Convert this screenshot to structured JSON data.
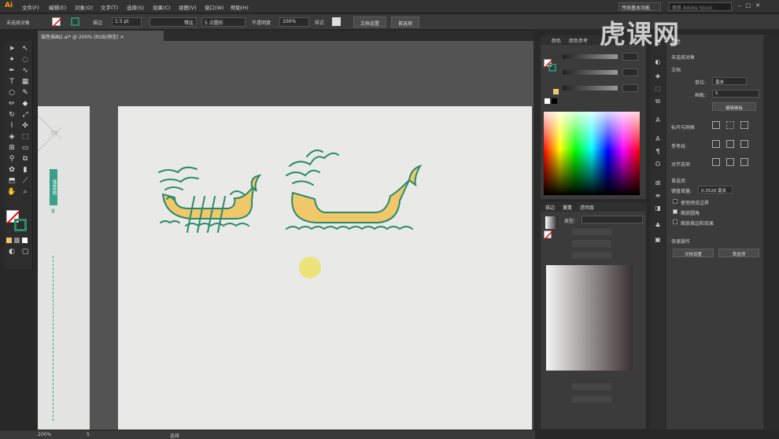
{
  "app": {
    "logo": "Ai",
    "menu": [
      "文件(F)",
      "编辑(E)",
      "对象(O)",
      "文字(T)",
      "选择(S)",
      "效果(C)",
      "视图(V)",
      "窗口(W)",
      "帮助(H)"
    ],
    "workspace": "传统基本功能",
    "search_placeholder": "搜索 Adobe Stock"
  },
  "control": {
    "selection": "未选择对象",
    "stroke_label": "描边",
    "stroke_weight": "1.5 pt",
    "stroke_profile": "等比",
    "brush": "5 点圆形",
    "opacity_label": "不透明度",
    "opacity": "100%",
    "style_label": "样式",
    "doc_setup": "文档设置",
    "prefs": "首选项"
  },
  "document": {
    "tab": "端性插画2.ai* @ 200% (RGB/预览)"
  },
  "status": {
    "zoom": "200%",
    "page": "5",
    "tool": "选择"
  },
  "side_page": {
    "label": "19",
    "badge": "插画绘制",
    "text": "置"
  },
  "color_panel": {
    "tabs": [
      "颜色",
      "颜色参考"
    ]
  },
  "gradient_panel": {
    "tabs": [
      "描边",
      "渐变",
      "透明度"
    ],
    "type_label": "类型:"
  },
  "props": {
    "title": "属性",
    "subtitle": "未选择对象",
    "doc_label": "文档",
    "unit_label": "单位:",
    "unit": "毫米",
    "artboard_label": "画板:",
    "artboard": "5",
    "edit_artboard": "编辑画板",
    "guides_label": "标尺与网格",
    "guides2": "参考线",
    "align_label": "对齐选项",
    "prefs_label": "首选项",
    "keyboard_label": "键盘增量:",
    "keyboard": "0.3528 毫米",
    "opt1": "使用预览边界",
    "opt2": "缩放圆角",
    "opt3": "缩放描边和效果",
    "quick_label": "快速操作",
    "doc_setup": "文档设置",
    "prefs_btn": "首选项"
  },
  "watermark": "虎课网",
  "colors": {
    "dragon_fill": "#f0c86a",
    "dragon_stroke": "#2a8a6a",
    "dot": "#ece47a"
  }
}
